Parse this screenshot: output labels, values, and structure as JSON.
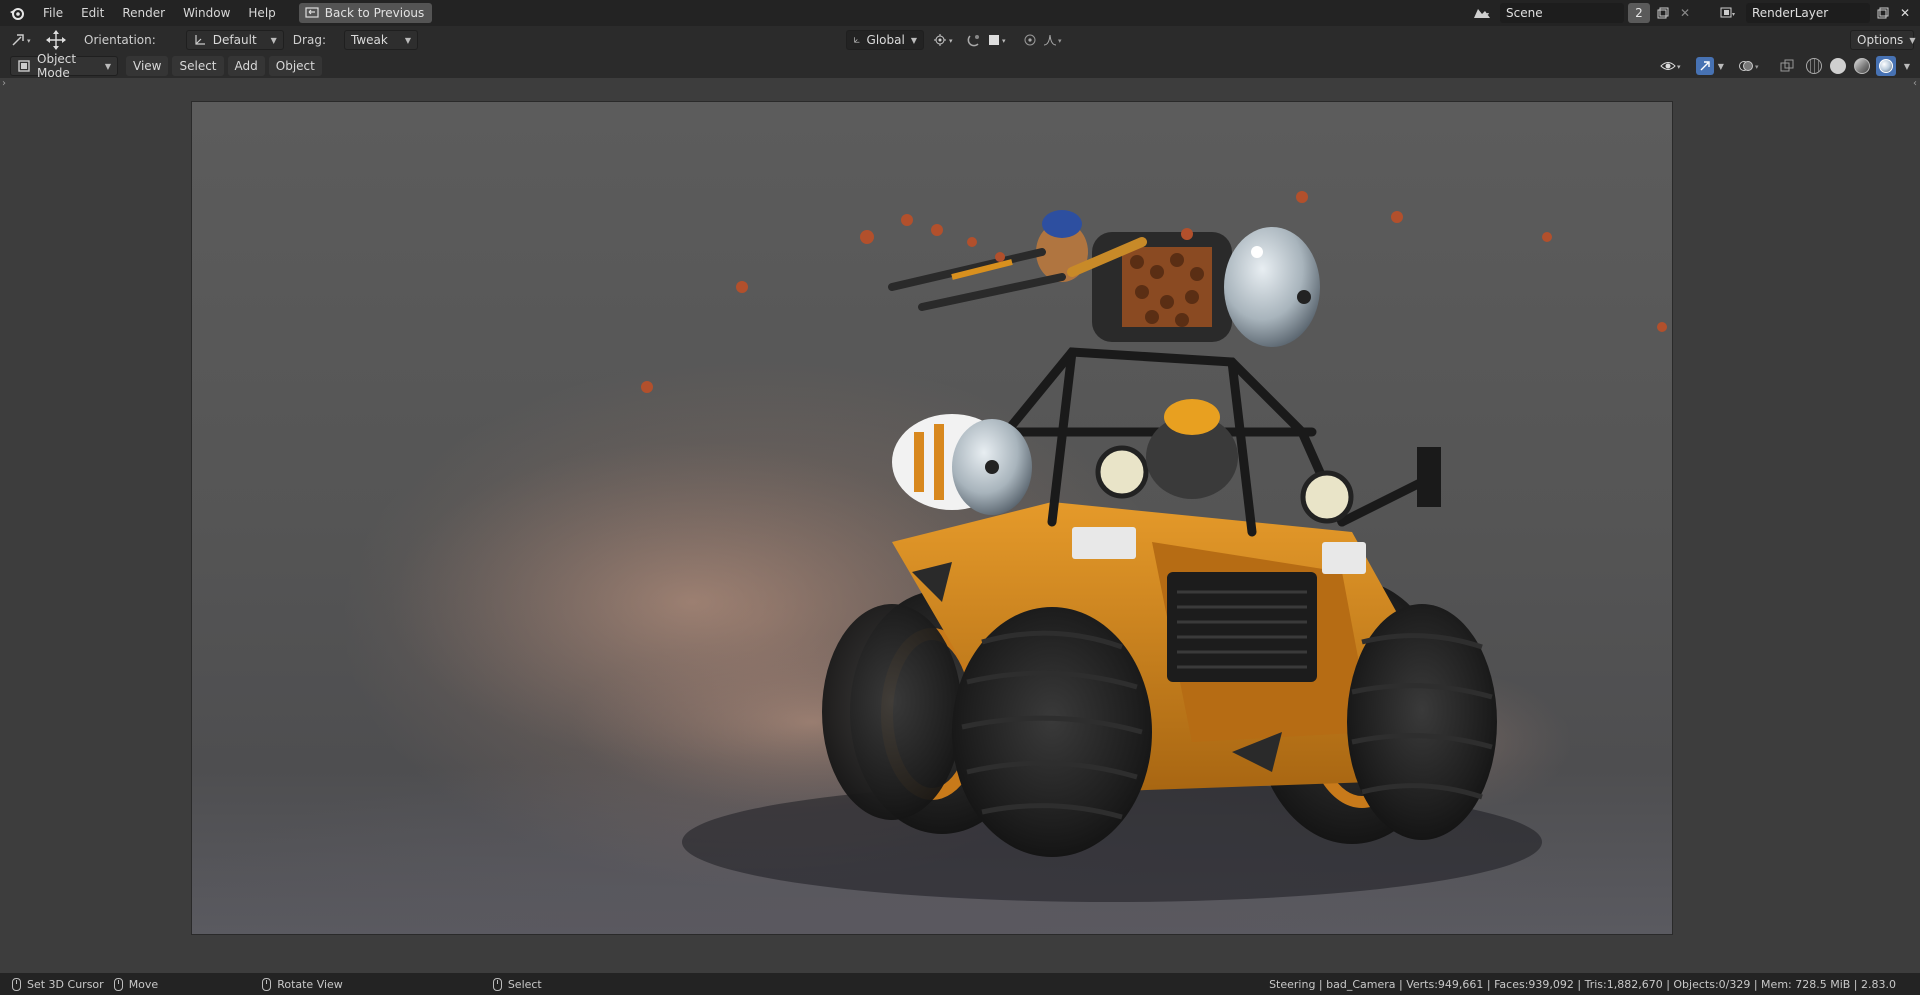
{
  "topbar": {
    "menu": [
      "File",
      "Edit",
      "Render",
      "Window",
      "Help"
    ],
    "back_button": "Back to Previous",
    "scene_name": "Scene",
    "scene_users": "2",
    "render_layer": "RenderLayer",
    "options": "Options"
  },
  "toolbar": {
    "orientation_label": "Orientation:",
    "orientation_value": "Default",
    "drag_label": "Drag:",
    "drag_value": "Tweak",
    "transform_orientation": "Global"
  },
  "header": {
    "mode": "Object Mode",
    "view": "View",
    "select": "Select",
    "add": "Add",
    "object": "Object"
  },
  "statusbar": {
    "set_cursor": "Set 3D Cursor",
    "move": "Move",
    "rotate": "Rotate View",
    "select": "Select",
    "stats": "Steering | bad_Camera | Verts:949,661 | Faces:939,092 | Tris:1,882,670 | Objects:0/329 | Mem: 728.5 MiB | 2.83.0"
  },
  "colors": {
    "accent": "#4772b3",
    "vehicle_orange": "#d48a22",
    "background": "#3d3d3d"
  }
}
